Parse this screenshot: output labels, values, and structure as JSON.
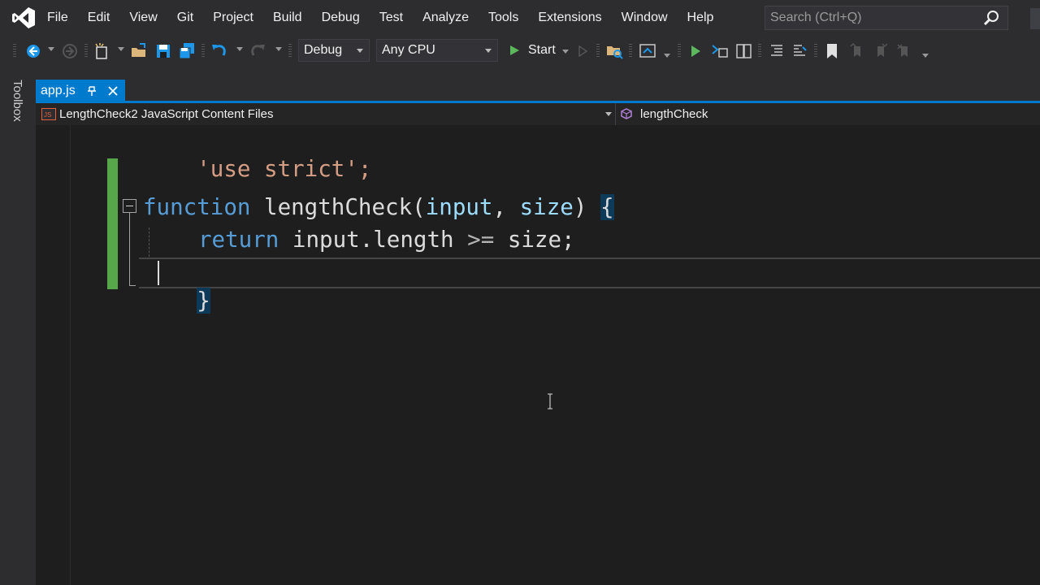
{
  "menubar": {
    "items": [
      "File",
      "Edit",
      "View",
      "Git",
      "Project",
      "Build",
      "Debug",
      "Test",
      "Analyze",
      "Tools",
      "Extensions",
      "Window",
      "Help"
    ],
    "search_placeholder": "Search (Ctrl+Q)"
  },
  "toolbar": {
    "configuration": "Debug",
    "platform": "Any CPU",
    "start_label": "Start"
  },
  "toolbox": {
    "label": "Toolbox"
  },
  "tab": {
    "label": "app.js"
  },
  "navbar": {
    "project": "LengthCheck2 JavaScript Content Files",
    "member": "lengthCheck"
  },
  "code": {
    "line1": "'use strict';",
    "line2_keyword": "function",
    "line2_name": "lengthCheck",
    "line2_open_paren": "(",
    "line2_param1": "input",
    "line2_comma": ", ",
    "line2_param2": "size",
    "line2_close": ") ",
    "line2_brace": "{",
    "line3_keyword": "return",
    "line3_rest1": "input.length ",
    "line3_op": ">=",
    "line3_rest2": " size;",
    "line4_brace": "}"
  },
  "colors": {
    "accent": "#007acc",
    "change_bar": "#57a64a",
    "keyword": "#569cd6",
    "string": "#d69d85",
    "parameter": "#9cdcfe"
  }
}
